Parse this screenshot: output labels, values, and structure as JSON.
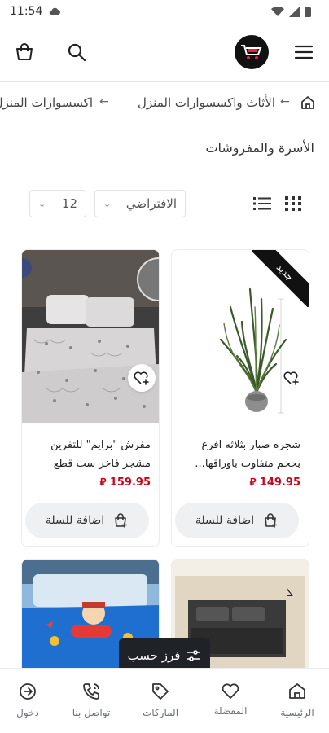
{
  "status_bar": {
    "time": "11:54"
  },
  "breadcrumb": {
    "items": [
      "الأثاث واكسسوارات المنزل",
      "اكسسوارات المنزل"
    ],
    "separator": "←"
  },
  "page_title": "الأسرة والمفروشات",
  "toolbar": {
    "sort_value": "الافتراضي",
    "per_page_value": "12"
  },
  "products": [
    {
      "name": "شجره صبار بثلاثه افرع\nبحجم متفاوت باوراقها...",
      "price": "149.95 ⃁",
      "add_label": "اضافة للسلة",
      "badge": "جديد"
    },
    {
      "name": "مفرش \"برايم\" للتفرين\nمشجر فاخر ست قطع",
      "price": "159.95 ⃁",
      "add_label": "اضافة للسلة"
    }
  ],
  "sort_button": {
    "label": "فرز حسب"
  },
  "bottom_nav": {
    "items": [
      {
        "label": "الرئيسية",
        "icon": "home-icon"
      },
      {
        "label": "المفضلة",
        "icon": "heart-icon"
      },
      {
        "label": "الماركات",
        "icon": "tag-icon"
      },
      {
        "label": "تواصل بنا",
        "icon": "phone-icon"
      },
      {
        "label": "دخول",
        "icon": "login-icon"
      }
    ]
  },
  "colors": {
    "price": "#d0021b",
    "sort_button_bg": "#1f2328",
    "nav_text": "#6d7075"
  }
}
